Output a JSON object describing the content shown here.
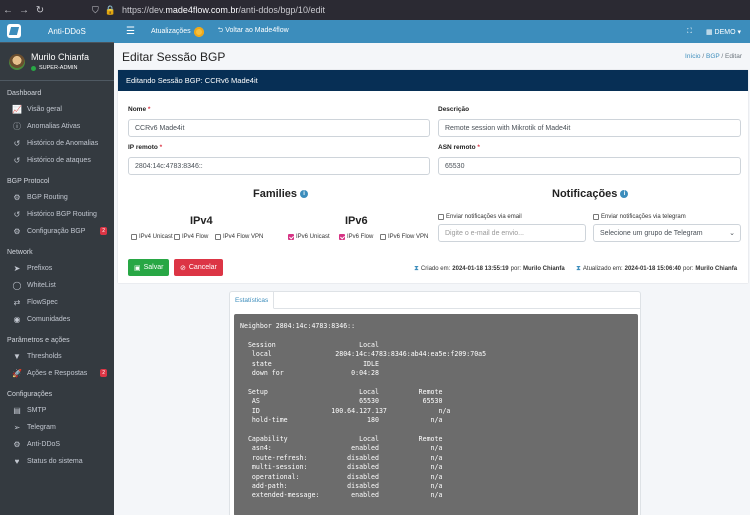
{
  "browser": {
    "url_prefix": "https://dev.",
    "url_host": "made4flow.com.br",
    "url_path": "/anti-ddos/bgp/10/edit"
  },
  "brand": {
    "name": "Anti-DDoS"
  },
  "user": {
    "name": "Murilo Chianfa",
    "role": "SUPER-ADMIN"
  },
  "sidebar": {
    "sections": [
      {
        "title": "Dashboard",
        "items": [
          {
            "label": "Visão geral",
            "icon": "chart-line-icon",
            "glyph": "📈"
          },
          {
            "label": "Anomalias Ativas",
            "icon": "info-circle-icon",
            "glyph": "ⓘ"
          },
          {
            "label": "Histórico de Anomalias",
            "icon": "history-icon",
            "glyph": "↺"
          },
          {
            "label": "Histórico de ataques",
            "icon": "history-icon",
            "glyph": "↺"
          }
        ]
      },
      {
        "title": "BGP Protocol",
        "items": [
          {
            "label": "BGP Routing",
            "icon": "network-icon",
            "glyph": "⚙"
          },
          {
            "label": "Histórico BGP Routing",
            "icon": "history-icon",
            "glyph": "↺"
          },
          {
            "label": "Configuração BGP",
            "icon": "cog-icon",
            "glyph": "⚙",
            "badge": "2"
          }
        ]
      },
      {
        "title": "Network",
        "items": [
          {
            "label": "Prefixos",
            "icon": "forward-icon",
            "glyph": "➤"
          },
          {
            "label": "WhiteList",
            "icon": "circle-icon",
            "glyph": "◯"
          },
          {
            "label": "FlowSpec",
            "icon": "filter-icon",
            "glyph": "⇄"
          },
          {
            "label": "Comunidades",
            "icon": "globe-icon",
            "glyph": "◉"
          }
        ]
      },
      {
        "title": "Parâmetros e ações",
        "items": [
          {
            "label": "Thresholds",
            "icon": "filter-icon",
            "glyph": "▼"
          },
          {
            "label": "Ações e Respostas",
            "icon": "rocket-icon",
            "glyph": "🚀",
            "badge": "2"
          }
        ]
      },
      {
        "title": "Configurações",
        "items": [
          {
            "label": "SMTP",
            "icon": "server-icon",
            "glyph": "▤"
          },
          {
            "label": "Telegram",
            "icon": "send-icon",
            "glyph": "➢"
          },
          {
            "label": "Anti-DDoS",
            "icon": "cogs-icon",
            "glyph": "⚙"
          },
          {
            "label": "Status do sistema",
            "icon": "heartbeat-icon",
            "glyph": "♥"
          }
        ]
      }
    ]
  },
  "topbar": {
    "updates": "Atualizações",
    "back": "Voltar ao Made4flow",
    "account": "DEMO"
  },
  "page": {
    "title": "Editar Sessão BGP",
    "breadcrumb": [
      "Início",
      "BGP",
      "Editar"
    ]
  },
  "form": {
    "header": "Editando Sessão BGP: CCRv6 Made4it",
    "nome_label": "Nome",
    "nome_value": "CCRv6 Made4it",
    "descricao_label": "Descrição",
    "descricao_value": "Remote session with Mikrotik of Made4it",
    "ip_label": "IP remoto",
    "ip_value": "2804:14c:4783:8346::",
    "asn_label": "ASN remoto",
    "asn_value": "65530",
    "families_title": "Families",
    "ipv4_title": "IPv4",
    "ipv6_title": "IPv6",
    "ipv4_options": [
      {
        "label": "IPv4 Unicast",
        "checked": false
      },
      {
        "label": "IPv4 Flow",
        "checked": false
      },
      {
        "label": "IPv4 Flow VPN",
        "checked": false
      }
    ],
    "ipv6_options": [
      {
        "label": "IPv6 Unicast",
        "checked": true
      },
      {
        "label": "IPv6 Flow",
        "checked": true
      },
      {
        "label": "IPv6 Flow VPN",
        "checked": false
      }
    ],
    "notif_title": "Notificações",
    "email_check": "Enviar notificações via email",
    "telegram_check": "Enviar notificações via telegram",
    "email_placeholder": "Digite o e-mail de envio...",
    "telegram_select": "Selecione um grupo de Telegram",
    "save": "Salvar",
    "cancel": "Cancelar",
    "created_label": "Criado em:",
    "created_at": "2024-01-18 13:55:19",
    "created_by_label": "por:",
    "created_by": "Murilo Chianfa",
    "updated_label": "Atualizado em:",
    "updated_at": "2024-01-18 15:06:40",
    "updated_by_label": "por:",
    "updated_by": "Murilo Chianfa"
  },
  "stats": {
    "tab": "Estatísticas",
    "output": "Neighbor 2804:14c:4783:8346::\n\n  Session                     Local\n   local                2804:14c:4783:8346:ab44:ea5e:f209:70a5\n   state                       IDLE\n   down for                 0:04:28\n\n  Setup                       Local          Remote\n   AS                         65530           65530\n   ID                  100.64.127.137             n/a\n   hold-time                    180             n/a\n\n  Capability                  Local          Remote\n   asn4:                    enabled             n/a\n   route-refresh:          disabled             n/a\n   multi-session:          disabled             n/a\n   operational:            disabled             n/a\n   add-path:               disabled             n/a\n   extended-message:        enabled             n/a"
  },
  "colors": {
    "accent": "#3c8dbc",
    "sidebar": "#343a40",
    "card_header": "#072f55",
    "save": "#28a745",
    "cancel": "#dc3545"
  }
}
